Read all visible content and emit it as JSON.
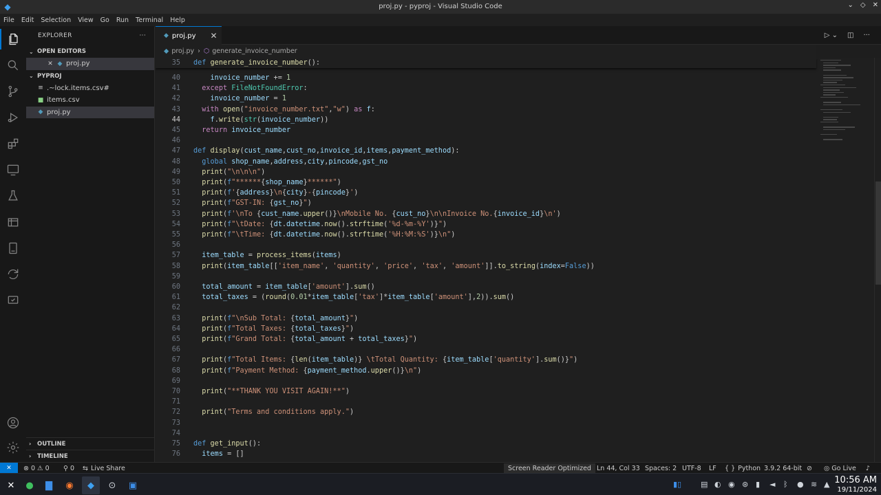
{
  "window": {
    "title": "proj.py - pyproj - Visual Studio Code"
  },
  "menu": [
    "File",
    "Edit",
    "Selection",
    "View",
    "Go",
    "Run",
    "Terminal",
    "Help"
  ],
  "sidebar": {
    "title": "EXPLORER",
    "more": "···",
    "open_editors": {
      "label": "OPEN EDITORS",
      "items": [
        {
          "name": "proj.py",
          "close": "✕"
        }
      ]
    },
    "project": {
      "label": "PYPROJ",
      "files": [
        {
          "name": ".~lock.items.csv#",
          "icon": "file-icon"
        },
        {
          "name": "items.csv",
          "icon": "csv-icon"
        },
        {
          "name": "proj.py",
          "icon": "python-icon"
        }
      ]
    },
    "outline": "OUTLINE",
    "timeline": "TIMELINE"
  },
  "tab": {
    "name": "proj.py",
    "close": "✕"
  },
  "breadcrumb": {
    "file": "proj.py",
    "symbol": "generate_invoice_number"
  },
  "editor": {
    "current_line": 44,
    "sticky": {
      "n": 35,
      "html": "<span class='d'>def</span> <span class='f'>generate_invoice_number</span>():"
    },
    "lines": [
      {
        "n": 40,
        "html": "    <span class='v'>invoice_number</span> += <span class='n'>1</span>"
      },
      {
        "n": 41,
        "html": "  <span class='k'>except</span> <span class='c'>FileNotFoundError</span>:"
      },
      {
        "n": 42,
        "html": "    <span class='v'>invoice_number</span> = <span class='n'>1</span>"
      },
      {
        "n": 43,
        "html": "  <span class='k'>with</span> <span class='f'>open</span>(<span class='s'>\"invoice_number.txt\"</span>,<span class='s'>\"w\"</span>) <span class='k'>as</span> <span class='v'>f</span>:"
      },
      {
        "n": 44,
        "html": "    <span class='v'>f</span>.<span class='f'>write</span>(<span class='c'>str</span>(<span class='v'>invoice_number</span>))"
      },
      {
        "n": 45,
        "html": "  <span class='k'>return</span> <span class='v'>invoice_number</span>"
      },
      {
        "n": 46,
        "html": ""
      },
      {
        "n": 47,
        "html": "<span class='d'>def</span> <span class='f'>display</span>(<span class='v'>cust_name</span>,<span class='v'>cust_no</span>,<span class='v'>invoice_id</span>,<span class='v'>items</span>,<span class='v'>payment_method</span>):"
      },
      {
        "n": 48,
        "html": "  <span class='d'>global</span> <span class='v'>shop_name</span>,<span class='v'>address</span>,<span class='v'>city</span>,<span class='v'>pincode</span>,<span class='v'>gst_no</span>"
      },
      {
        "n": 49,
        "html": "  <span class='f'>print</span>(<span class='s'>\"\\n\\n\\n\"</span>)"
      },
      {
        "n": 50,
        "html": "  <span class='f'>print</span>(<span class='d'>f</span><span class='s'>\"******</span>{<span class='v'>shop_name</span>}<span class='s'>******\"</span>)"
      },
      {
        "n": 51,
        "html": "  <span class='f'>print</span>(<span class='d'>f</span><span class='s'>'</span>{<span class='v'>address</span>}<span class='s'>\\n</span>{<span class='v'>city</span>}<span class='s'>-</span>{<span class='v'>pincode</span>}<span class='s'>'</span>)"
      },
      {
        "n": 52,
        "html": "  <span class='f'>print</span>(<span class='d'>f</span><span class='s'>\"GST-IN: </span>{<span class='v'>gst_no</span>}<span class='s'>\"</span>)"
      },
      {
        "n": 53,
        "html": "  <span class='f'>print</span>(<span class='d'>f</span><span class='s'>'\\nTo </span>{<span class='v'>cust_name</span>.<span class='f'>upper</span>()}<span class='s'>\\nMobile No. </span>{<span class='v'>cust_no</span>}<span class='s'>\\n\\nInvoice No.</span>{<span class='v'>invoice_id</span>}<span class='s'>\\n'</span>)"
      },
      {
        "n": 54,
        "html": "  <span class='f'>print</span>(<span class='d'>f</span><span class='s'>\"\\tDate: </span>{<span class='v'>dt</span>.<span class='v'>datetime</span>.<span class='f'>now</span>().<span class='f'>strftime</span>(<span class='s'>'%d-%m-%Y'</span>)}<span class='s'>\"</span>)"
      },
      {
        "n": 55,
        "html": "  <span class='f'>print</span>(<span class='d'>f</span><span class='s'>\"\\tTime: </span>{<span class='v'>dt</span>.<span class='v'>datetime</span>.<span class='f'>now</span>().<span class='f'>strftime</span>(<span class='s'>'%H:%M:%S'</span>)}<span class='s'>\\n\"</span>)"
      },
      {
        "n": 56,
        "html": ""
      },
      {
        "n": 57,
        "html": "  <span class='v'>item_table</span> = <span class='f'>process_items</span>(<span class='v'>items</span>)"
      },
      {
        "n": 58,
        "html": "  <span class='f'>print</span>(<span class='v'>item_table</span>[[<span class='s'>'item_name'</span>, <span class='s'>'quantity'</span>, <span class='s'>'price'</span>, <span class='s'>'tax'</span>, <span class='s'>'amount'</span>]].<span class='f'>to_string</span>(<span class='v'>index</span>=<span class='d'>False</span>))"
      },
      {
        "n": 59,
        "html": ""
      },
      {
        "n": 60,
        "html": "  <span class='v'>total_amount</span> = <span class='v'>item_table</span>[<span class='s'>'amount'</span>].<span class='f'>sum</span>()"
      },
      {
        "n": 61,
        "html": "  <span class='v'>total_taxes</span> = (<span class='f'>round</span>(<span class='n'>0.01</span>*<span class='v'>item_table</span>[<span class='s'>'tax'</span>]*<span class='v'>item_table</span>[<span class='s'>'amount'</span>],<span class='n'>2</span>)).<span class='f'>sum</span>()"
      },
      {
        "n": 62,
        "html": ""
      },
      {
        "n": 63,
        "html": "  <span class='f'>print</span>(<span class='d'>f</span><span class='s'>\"\\nSub Total: </span>{<span class='v'>total_amount</span>}<span class='s'>\"</span>)"
      },
      {
        "n": 64,
        "html": "  <span class='f'>print</span>(<span class='d'>f</span><span class='s'>\"Total Taxes: </span>{<span class='v'>total_taxes</span>}<span class='s'>\"</span>)"
      },
      {
        "n": 65,
        "html": "  <span class='f'>print</span>(<span class='d'>f</span><span class='s'>\"Grand Total: </span>{<span class='v'>total_amount</span> + <span class='v'>total_taxes</span>}<span class='s'>\"</span>)"
      },
      {
        "n": 66,
        "html": ""
      },
      {
        "n": 67,
        "html": "  <span class='f'>print</span>(<span class='d'>f</span><span class='s'>\"Total Items: </span>{<span class='f'>len</span>(<span class='v'>item_table</span>)}<span class='s'> \\tTotal Quantity: </span>{<span class='v'>item_table</span>[<span class='s'>'quantity'</span>].<span class='f'>sum</span>()}<span class='s'>\"</span>)"
      },
      {
        "n": 68,
        "html": "  <span class='f'>print</span>(<span class='d'>f</span><span class='s'>\"Payment Method: </span>{<span class='v'>payment_method</span>.<span class='f'>upper</span>()}<span class='s'>\\n\"</span>)"
      },
      {
        "n": 69,
        "html": ""
      },
      {
        "n": 70,
        "html": "  <span class='f'>print</span>(<span class='s'>\"**THANK YOU VISIT AGAIN!**\"</span>)"
      },
      {
        "n": 71,
        "html": ""
      },
      {
        "n": 72,
        "html": "  <span class='f'>print</span>(<span class='s'>\"Terms and conditions apply.\"</span>)"
      },
      {
        "n": 73,
        "html": ""
      },
      {
        "n": 74,
        "html": ""
      },
      {
        "n": 75,
        "html": "<span class='d'>def</span> <span class='f'>get_input</span>():"
      },
      {
        "n": 76,
        "html": "  <span class='v'>items</span> = []"
      }
    ]
  },
  "statusbar": {
    "remote": "✕",
    "problems": "⊗ 0 ⚠ 0",
    "ports": "⚲ 0",
    "liveshare": "Live Share",
    "screen_reader": "Screen Reader Optimized",
    "cursor": "Ln 44, Col 33",
    "spaces": "Spaces: 2",
    "encoding": "UTF-8",
    "eol": "LF",
    "language": "Python",
    "interpreter": "3.9.2 64-bit",
    "golive": "Go Live",
    "bell": "🔔"
  },
  "taskbar": {
    "time": "10:56 AM",
    "date": "19/11/2024"
  },
  "colors": {
    "accent": "#0078d4",
    "editor_bg": "#1f1f1f"
  }
}
